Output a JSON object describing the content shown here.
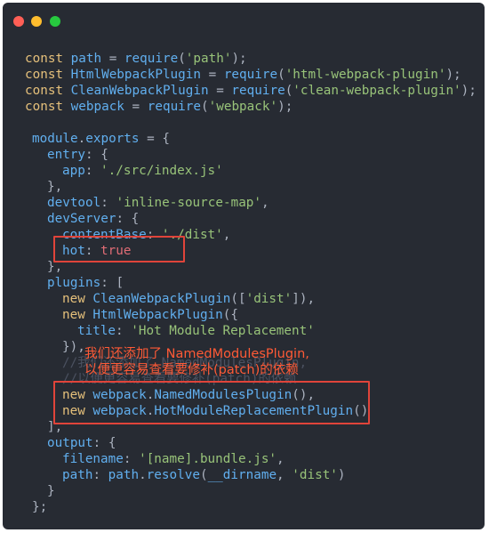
{
  "window": {
    "controls": [
      "close",
      "minimize",
      "maximize"
    ]
  },
  "code": {
    "l1": {
      "kw": "const",
      "name": "path",
      "eq": " = ",
      "fn": "require",
      "open": "(",
      "str": "'path'",
      "close": ");"
    },
    "l2": {
      "kw": "const",
      "name": "HtmlWebpackPlugin",
      "eq": " = ",
      "fn": "require",
      "open": "(",
      "str": "'html-webpack-plugin'",
      "close": ");"
    },
    "l3": {
      "kw": "const",
      "name": "CleanWebpackPlugin",
      "eq": " = ",
      "fn": "require",
      "open": "(",
      "str": "'clean-webpack-plugin'",
      "close": ");"
    },
    "l4": {
      "kw": "const",
      "name": "webpack",
      "eq": " = ",
      "fn": "require",
      "open": "(",
      "str": "'webpack'",
      "close": ");"
    },
    "l5": {
      "a": "module",
      "b": ".",
      "c": "exports",
      "d": " = {"
    },
    "l6": {
      "a": "entry",
      "b": ": {"
    },
    "l7": {
      "a": "app",
      "b": ": ",
      "c": "'./src/index.js'"
    },
    "l8": {
      "a": "},"
    },
    "l9": {
      "a": "devtool",
      "b": ": ",
      "c": "'inline-source-map'",
      "d": ","
    },
    "l10": {
      "a": "devServer",
      "b": ": {"
    },
    "l11": {
      "a": "contentBase",
      "b": ": ",
      "c": "'./dist'",
      "d": ","
    },
    "l12": {
      "a": "hot",
      "b": ": ",
      "c": "true"
    },
    "l13": {
      "a": "},"
    },
    "l14": {
      "a": "plugins",
      "b": ": ["
    },
    "l15": {
      "kw": "new",
      "name": " CleanWebpackPlugin",
      "open": "([",
      "str": "'dist'",
      "close": "]),"
    },
    "l16": {
      "kw": "new",
      "name": " HtmlWebpackPlugin",
      "open": "({"
    },
    "l17": {
      "a": "title",
      "b": ": ",
      "c": "'Hot Module Replacement'"
    },
    "l18": {
      "a": "}),"
    },
    "l19": {
      "a": "//我们还添加了 NamedModulesPlugin,"
    },
    "l20": {
      "a": "//以便更容易查看要修补(patch)的依赖"
    },
    "l21": {
      "kw": "new",
      "name": " webpack",
      "dot": ".",
      "fn": "NamedModulesPlugin",
      "close": "(),"
    },
    "l22": {
      "kw": "new",
      "name": " webpack",
      "dot": ".",
      "fn": "HotModuleReplacementPlugin",
      "close": "()"
    },
    "l23": {
      "a": "],"
    },
    "l24": {
      "a": "output",
      "b": ": {"
    },
    "l25": {
      "a": "filename",
      "b": ": ",
      "c": "'[name].bundle.js'",
      "d": ","
    },
    "l26": {
      "a": "path",
      "b": ": ",
      "c": "path",
      "d": ".",
      "e": "resolve",
      "f": "(",
      "g": "__dirname",
      "h": ", ",
      "i": "'dist'",
      "j": ")"
    },
    "l27": {
      "a": "}"
    },
    "l28": {
      "a": "};"
    }
  },
  "annotation": {
    "line1": "我们还添加了 NamedModulesPlugin,",
    "line2": "以便更容易查看要修补(patch)的依赖"
  },
  "colors": {
    "background": "#272b33",
    "annotation": "#ff5a36",
    "highlight_box": "#e0443a"
  }
}
